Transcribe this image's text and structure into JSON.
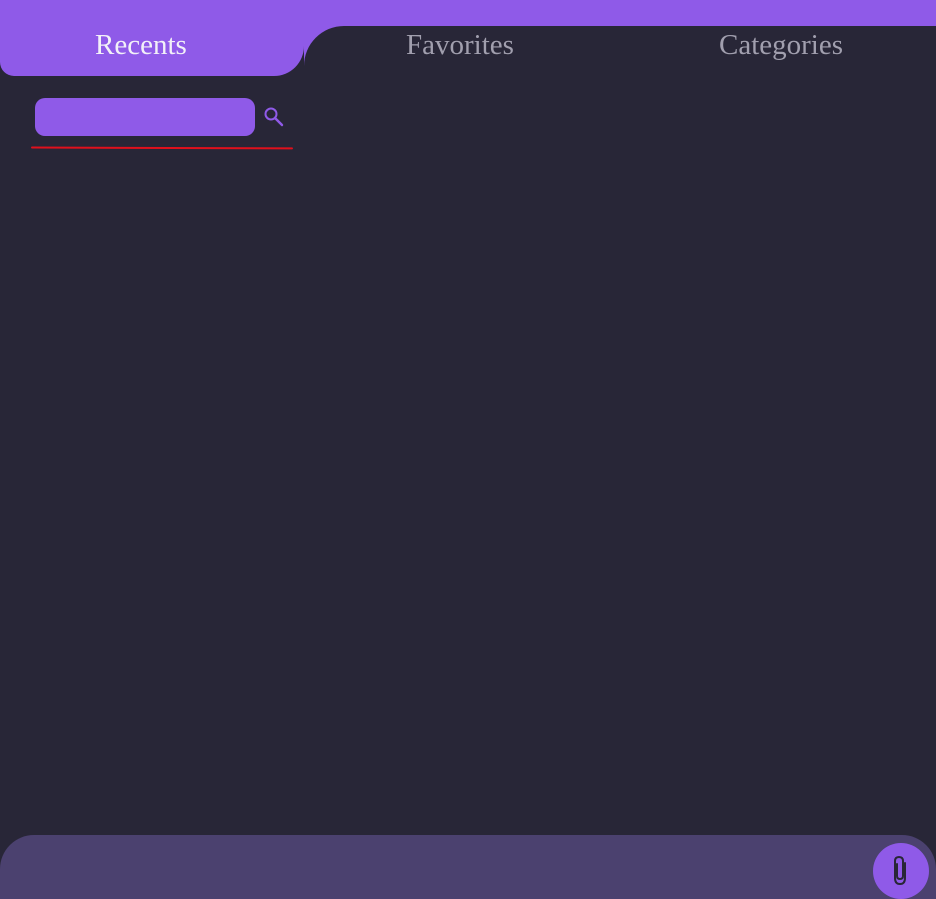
{
  "tabs": [
    {
      "label": "Recents",
      "active": true
    },
    {
      "label": "Favorites",
      "active": false
    },
    {
      "label": "Categories",
      "active": false
    }
  ],
  "search": {
    "value": "",
    "placeholder": "",
    "icon": "search-icon"
  },
  "bottom_bar": {
    "attach_icon": "paperclip-icon"
  },
  "colors": {
    "background": "#282637",
    "accent": "#8f5ae8",
    "bottom_bar": "#4b416f",
    "active_tab_text": "#f2f0f8",
    "inactive_tab_text": "#a19fae",
    "underline": "#e0101c"
  }
}
